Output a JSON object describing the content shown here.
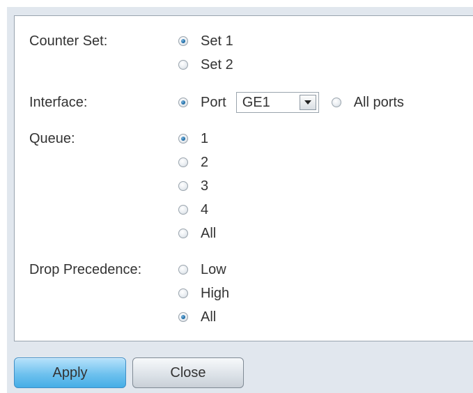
{
  "form": {
    "counter_set": {
      "label": "Counter Set:",
      "options": [
        {
          "label": "Set 1",
          "selected": true
        },
        {
          "label": "Set 2",
          "selected": false
        }
      ]
    },
    "interface": {
      "label": "Interface:",
      "port_option": {
        "label": "Port",
        "selected": true
      },
      "port_select": {
        "value": "GE1"
      },
      "all_ports_option": {
        "label": "All ports",
        "selected": false
      }
    },
    "queue": {
      "label": "Queue:",
      "options": [
        {
          "label": "1",
          "selected": true
        },
        {
          "label": "2",
          "selected": false
        },
        {
          "label": "3",
          "selected": false
        },
        {
          "label": "4",
          "selected": false
        },
        {
          "label": "All",
          "selected": false
        }
      ]
    },
    "drop_precedence": {
      "label": "Drop Precedence:",
      "options": [
        {
          "label": "Low",
          "selected": false
        },
        {
          "label": "High",
          "selected": false
        },
        {
          "label": "All",
          "selected": true
        }
      ]
    }
  },
  "buttons": {
    "apply_label": "Apply",
    "close_label": "Close"
  },
  "colors": {
    "background": "#e1e7ee",
    "panel": "#ffffff",
    "panel_border": "#98a3ae",
    "text": "#333333",
    "radio_selected": "#1f6ea8",
    "apply_button": "#6ec1ee",
    "close_button": "#dbe1e7"
  },
  "icons": {
    "dropdown": "chevron-down-icon"
  }
}
